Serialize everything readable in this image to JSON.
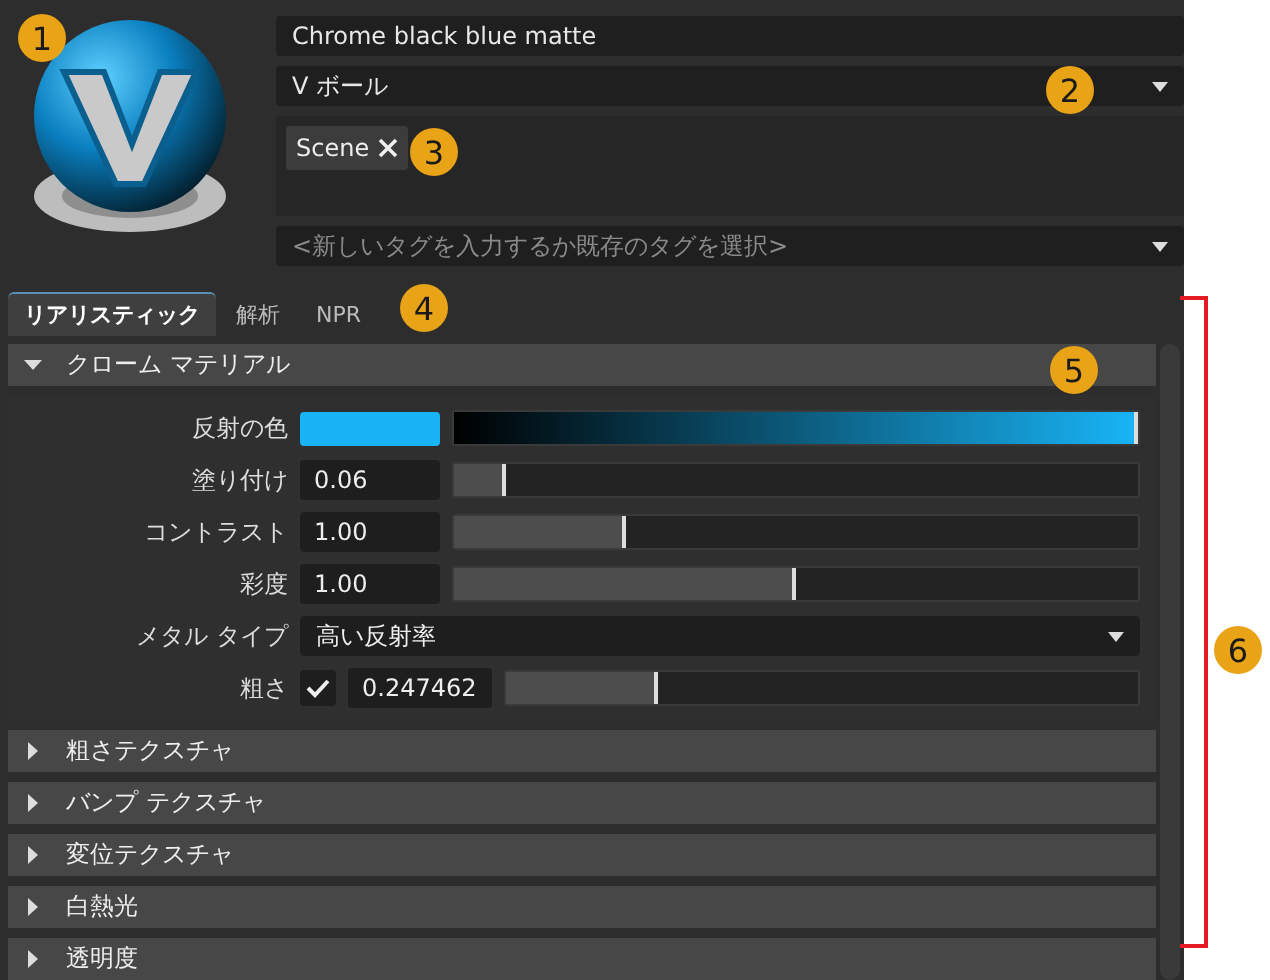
{
  "material": {
    "name": "Chrome black blue matte",
    "type": "V ボール",
    "tags": [
      {
        "label": "Scene"
      }
    ],
    "tag_placeholder": "<新しいタグを入力するか既存のタグを選択>"
  },
  "tabs": [
    {
      "label": "リアリスティック",
      "selected": true
    },
    {
      "label": "解析",
      "selected": false
    },
    {
      "label": "NPR",
      "selected": false
    }
  ],
  "sections": [
    {
      "title": "クローム マテリアル",
      "expanded": true,
      "rows": [
        {
          "kind": "color",
          "label": "反射の色",
          "color": "#18b4f6",
          "level": 1
        },
        {
          "kind": "slider",
          "label": "塗り付け",
          "value": "0.06",
          "level": 0.076
        },
        {
          "kind": "slider",
          "label": "コントラスト",
          "value": "1.00",
          "level": 0.25
        },
        {
          "kind": "slider",
          "label": "彩度",
          "value": "1.00",
          "level": 0.5
        },
        {
          "kind": "dropdown",
          "label": "メタル タイプ",
          "value": "高い反射率"
        },
        {
          "kind": "check_slider",
          "label": "粗さ",
          "checked": true,
          "value": "0.247462",
          "level": 0.24
        }
      ]
    },
    {
      "title": "粗さテクスチャ",
      "expanded": false
    },
    {
      "title": "バンプ テクスチャ",
      "expanded": false
    },
    {
      "title": "変位テクスチャ",
      "expanded": false
    },
    {
      "title": "白熱光",
      "expanded": false
    },
    {
      "title": "透明度",
      "expanded": false
    }
  ],
  "callouts": [
    "1",
    "2",
    "3",
    "4",
    "5",
    "6"
  ]
}
